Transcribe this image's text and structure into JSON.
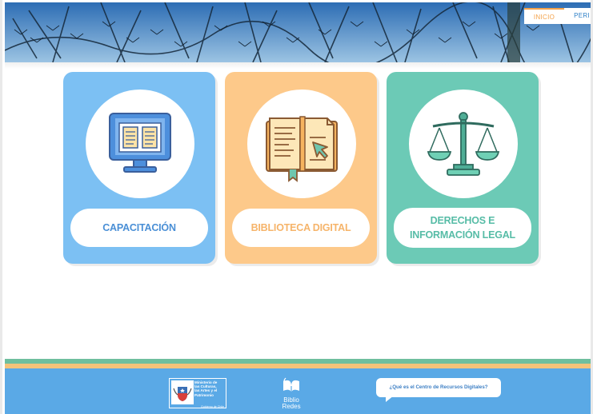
{
  "nav": {
    "items": [
      {
        "label": "INICIO"
      },
      {
        "label": "PERI"
      }
    ]
  },
  "cards": [
    {
      "title_lines": [
        "CAPACITACIÓN"
      ],
      "icon": "computer-book-icon",
      "color": "#7cc0f3"
    },
    {
      "title_lines": [
        "BIBLIOTECA DIGITAL"
      ],
      "icon": "digital-book-cursor-icon",
      "color": "#fdc98a"
    },
    {
      "title_lines": [
        "DERECHOS E",
        "INFORMACIÓN LEGAL"
      ],
      "icon": "scales-icon",
      "color": "#6ccab6"
    }
  ],
  "footer": {
    "ministry_lines": [
      "Ministerio de",
      "las Culturas,",
      "las Artes y el",
      "Patrimonio"
    ],
    "government": "Gobierno de Chile",
    "biblio_line1": "Biblio",
    "biblio_line2": "Redes",
    "help_question": "¿Qué es el Centro de Recursos Digitales?"
  },
  "colors": {
    "accent_orange": "#f4a24a",
    "accent_blue": "#2d7fc7",
    "footer_blue": "#5aa9e6",
    "stripe_green": "#6fbf9e",
    "stripe_orange": "#f4c37a"
  }
}
